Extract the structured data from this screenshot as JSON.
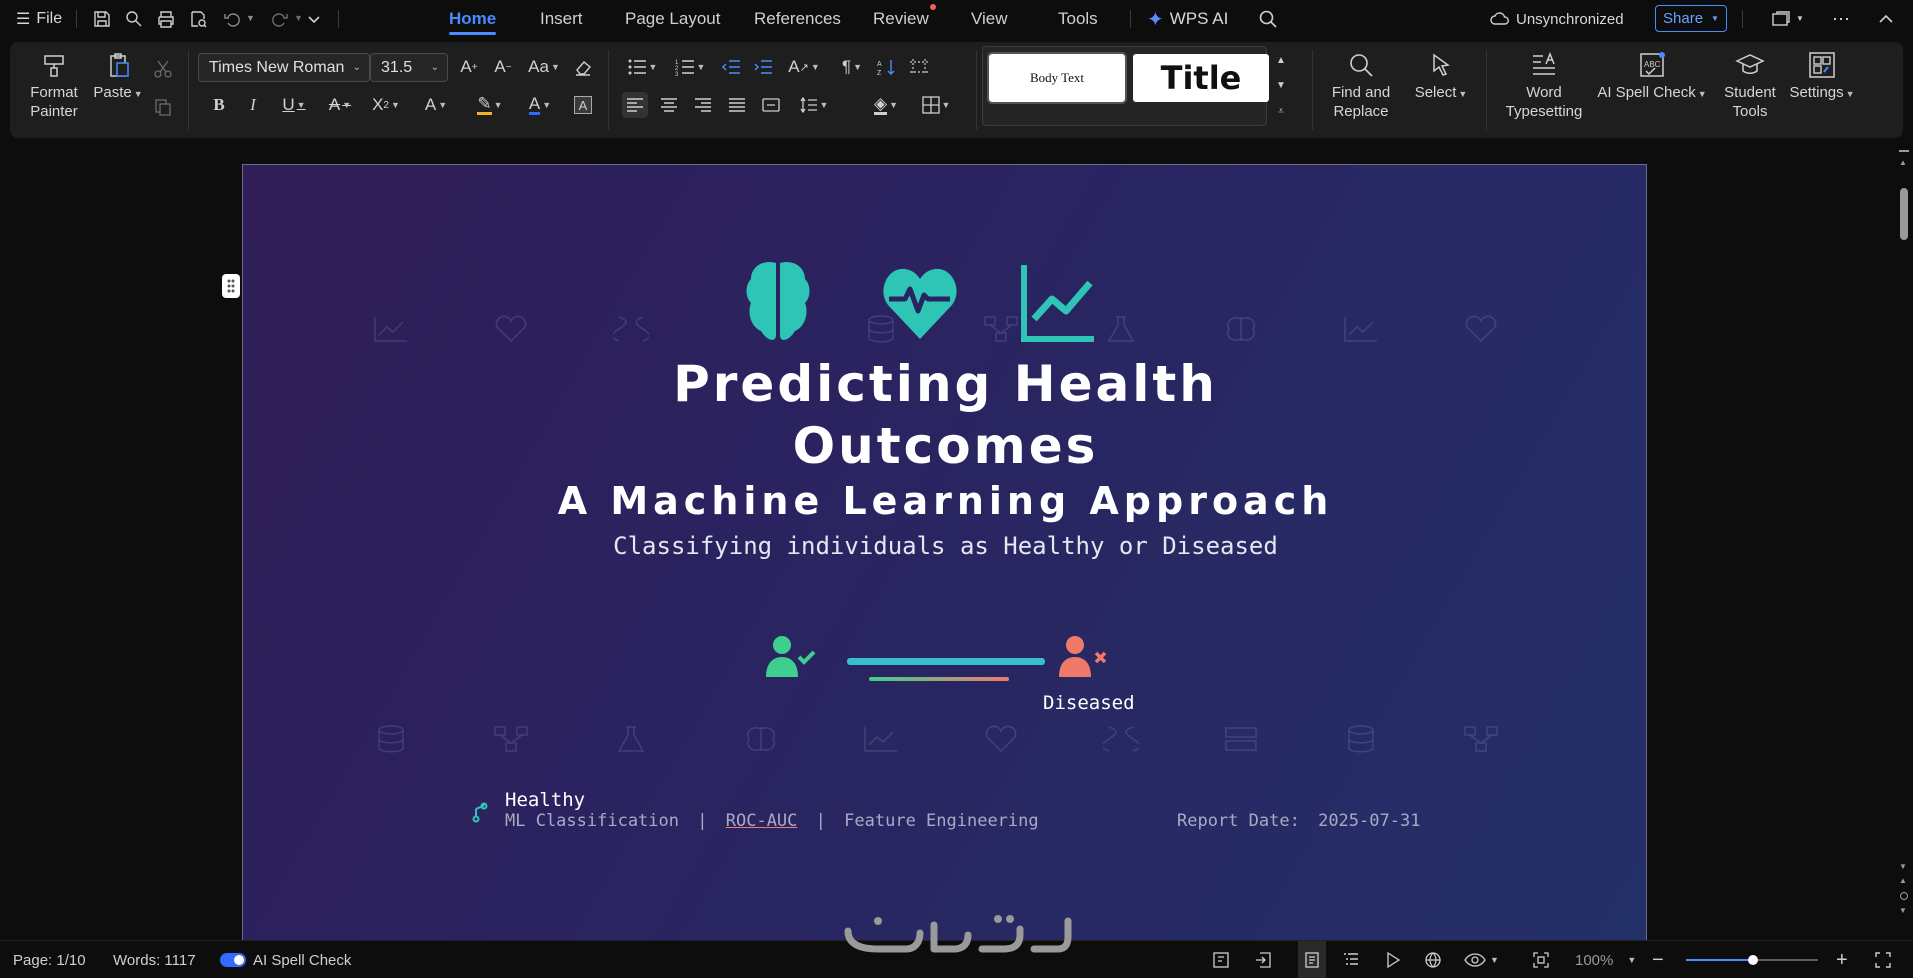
{
  "menu": {
    "file_label": "File",
    "tabs": [
      {
        "label": "Home",
        "active": true
      },
      {
        "label": "Insert",
        "active": false
      },
      {
        "label": "Page Layout",
        "active": false
      },
      {
        "label": "References",
        "active": false
      },
      {
        "label": "Review",
        "active": false,
        "has_dot": true
      },
      {
        "label": "View",
        "active": false
      },
      {
        "label": "Tools",
        "active": false
      }
    ],
    "wps_ai_label": "WPS AI",
    "sync_status": "Unsynchronized",
    "share_label": "Share"
  },
  "ribbon": {
    "format_painter_label": "Format\nPainter",
    "paste_label": "Paste",
    "font_name": "Times New Roman",
    "font_size": "31.5",
    "styles": {
      "body_text": "Body Text",
      "title": "Title"
    },
    "find_replace_label": "Find and\nReplace",
    "select_label": "Select",
    "word_typesetting_label": "Word\nTypesetting",
    "ai_spell_check_label": "AI Spell Check",
    "student_tools_label": "Student\nTools",
    "settings_label": "Settings"
  },
  "document": {
    "title_line1": "Predicting Health",
    "title_line2": "Outcomes",
    "subtitle": "A Machine Learning Approach",
    "tagline": "Classifying individuals as Healthy or Diseased",
    "diseased_label": "Diseased",
    "healthy_label": "Healthy",
    "keywords": [
      "ML Classification",
      "|",
      "ROC-AUC",
      "|",
      "Feature Engineering"
    ],
    "report_date_label": "Report Date:",
    "report_date": "2025-07-31",
    "colors": {
      "accent_teal": "#2ec4b6",
      "healthy_green": "#3ecf8e",
      "diseased_red": "#f07a6a"
    }
  },
  "status": {
    "page": "Page: 1/10",
    "words": "Words: 1117",
    "ai_spell_check": "AI Spell Check",
    "zoom": "100%"
  }
}
